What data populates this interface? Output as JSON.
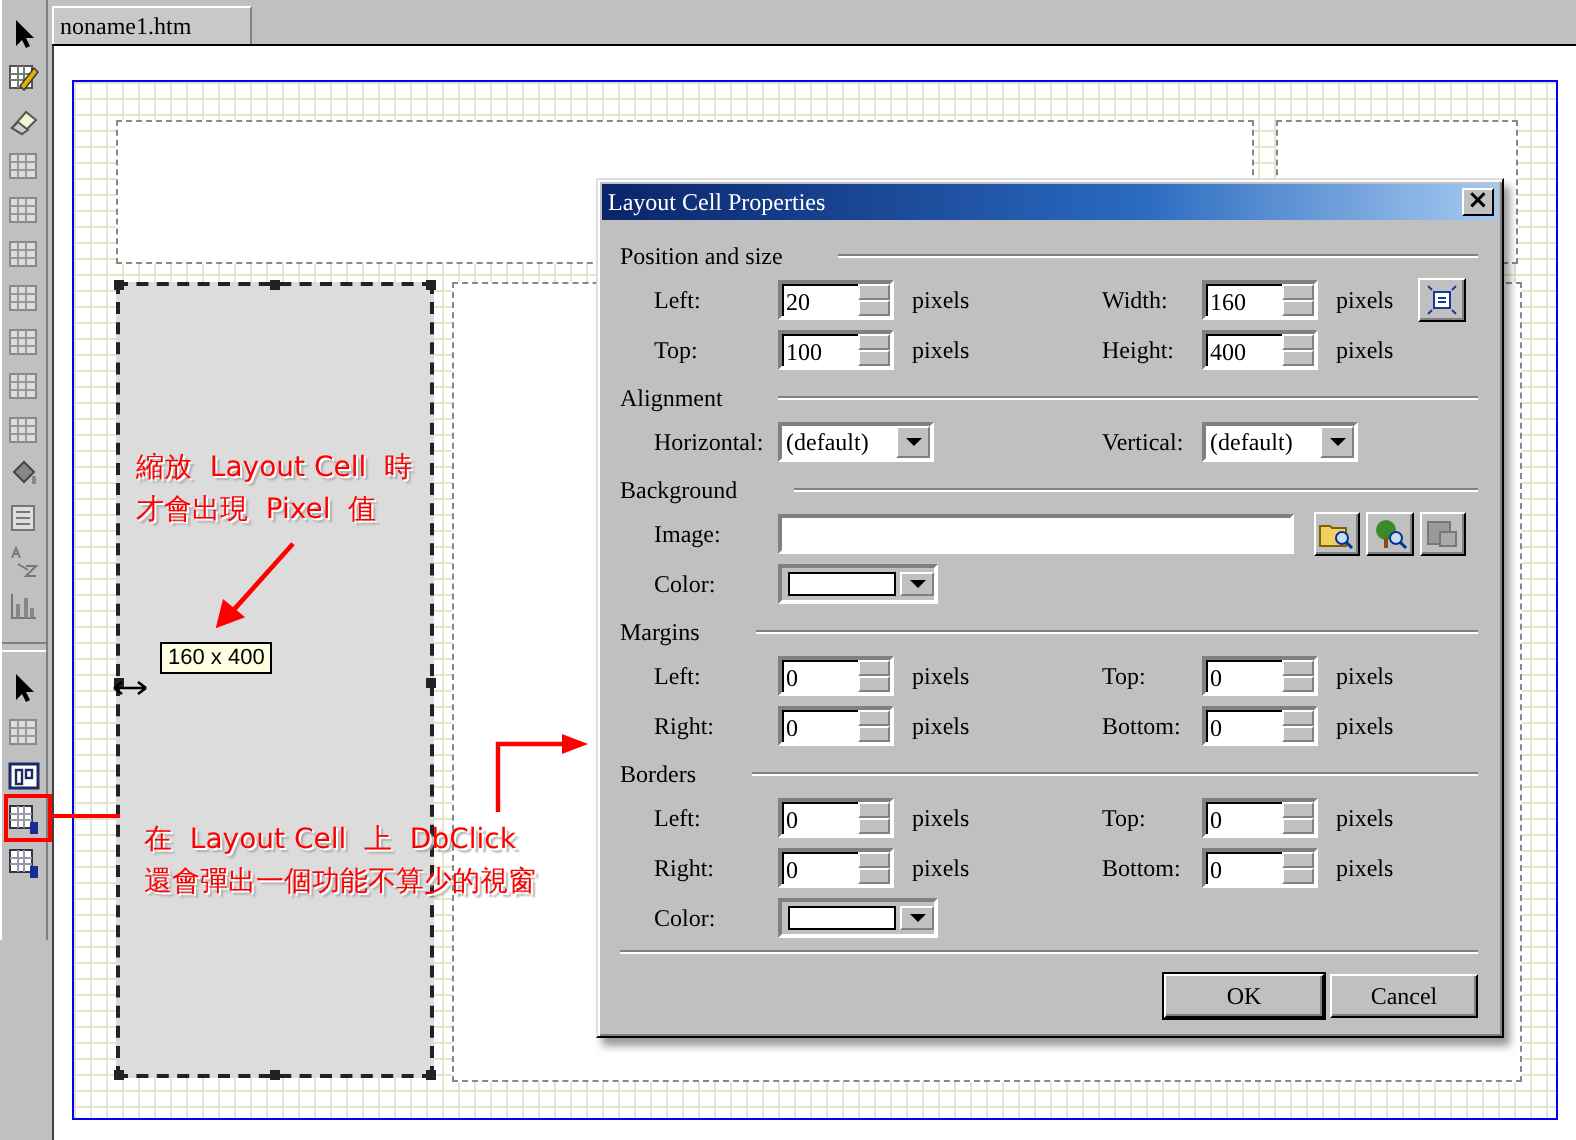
{
  "tabs": [
    {
      "label": "noname1.htm",
      "selected": true
    }
  ],
  "canvas": {
    "size_tooltip": "160 x 400"
  },
  "annotations": [
    {
      "lines": [
        "縮放  Layout Cell  時",
        "才會出現  Pixel  值"
      ]
    },
    {
      "lines": [
        "在  Layout Cell  上  DbClick",
        "還會彈出一個功能不算少的視窗"
      ]
    }
  ],
  "dialog": {
    "title": "Layout Cell Properties",
    "close": "×",
    "sections": [
      {
        "kind": "position",
        "title": "Position and size",
        "fields": [
          {
            "kind": "spin",
            "label": "Left:",
            "value": "20",
            "unit": "pixels"
          },
          {
            "kind": "spin",
            "label": "Width:",
            "value": "160",
            "unit": "pixels"
          },
          {
            "kind": "spin",
            "label": "Top:",
            "value": "100",
            "unit": "pixels"
          },
          {
            "kind": "spin",
            "label": "Height:",
            "value": "400",
            "unit": "pixels"
          }
        ]
      },
      {
        "kind": "alignment",
        "title": "Alignment",
        "fields": [
          {
            "kind": "select",
            "label": "Horizontal:",
            "value": "(default)"
          },
          {
            "kind": "select",
            "label": "Vertical:",
            "value": "(default)"
          }
        ]
      },
      {
        "kind": "background",
        "title": "Background",
        "fields": [
          {
            "kind": "path",
            "label": "Image:"
          },
          {
            "kind": "color",
            "label": "Color:"
          }
        ]
      },
      {
        "kind": "margins",
        "title": "Margins",
        "fields": [
          {
            "kind": "spin",
            "label": "Left:",
            "value": "0",
            "unit": "pixels"
          },
          {
            "kind": "spin",
            "label": "Top:",
            "value": "0",
            "unit": "pixels"
          },
          {
            "kind": "spin",
            "label": "Right:",
            "value": "0",
            "unit": "pixels"
          },
          {
            "kind": "spin",
            "label": "Bottom:",
            "value": "0",
            "unit": "pixels"
          }
        ]
      },
      {
        "kind": "borders",
        "title": "Borders",
        "fields": [
          {
            "kind": "spin",
            "label": "Left:",
            "value": "0",
            "unit": "pixels"
          },
          {
            "kind": "spin",
            "label": "Top:",
            "value": "0",
            "unit": "pixels"
          },
          {
            "kind": "spin",
            "label": "Right:",
            "value": "0",
            "unit": "pixels"
          },
          {
            "kind": "spin",
            "label": "Bottom:",
            "value": "0",
            "unit": "pixels"
          },
          {
            "kind": "color",
            "label": "Color:"
          }
        ]
      }
    ],
    "buttons": [
      {
        "label": "OK",
        "default": true
      },
      {
        "label": "Cancel",
        "default": false
      }
    ]
  }
}
